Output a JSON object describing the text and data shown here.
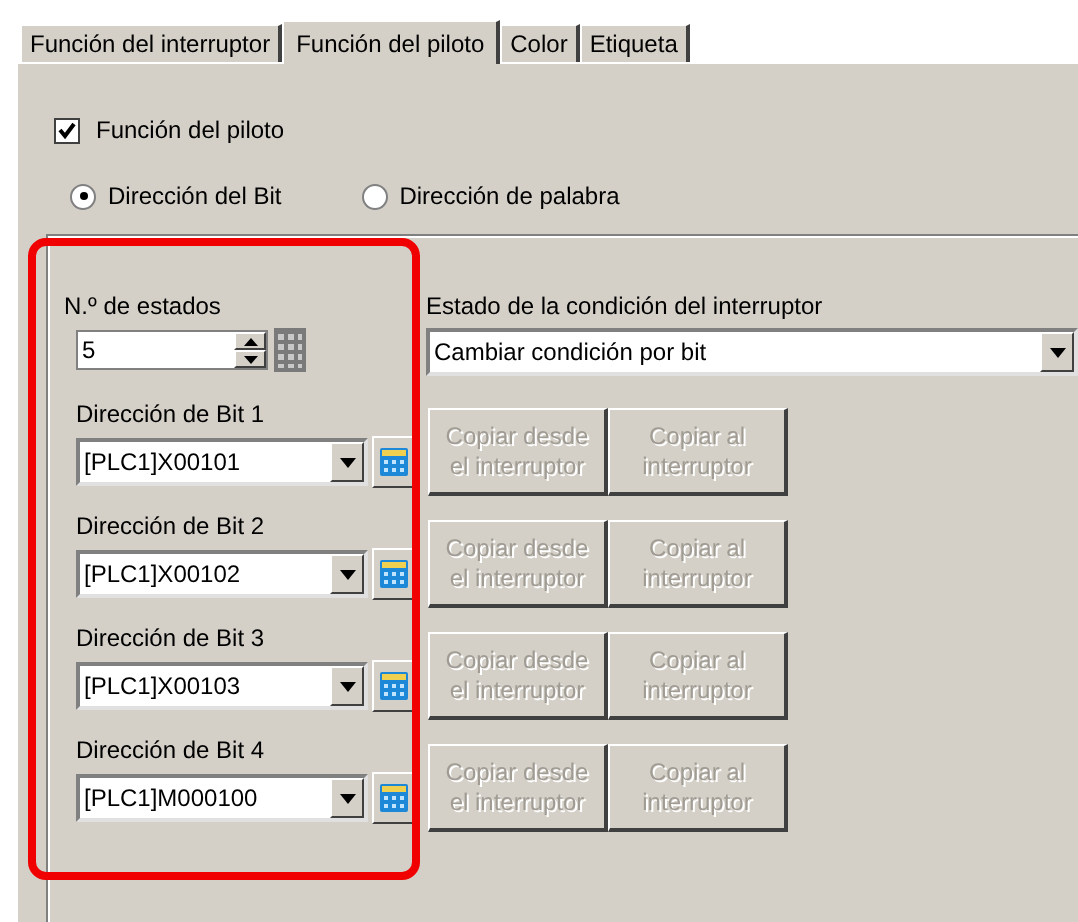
{
  "tabs": [
    {
      "label": "Función del interruptor",
      "selected": false
    },
    {
      "label": "Función del piloto",
      "selected": true
    },
    {
      "label": "Color",
      "selected": false
    },
    {
      "label": "Etiqueta",
      "selected": false
    }
  ],
  "pilot_checkbox": {
    "label": "Función del piloto",
    "checked": true
  },
  "address_type": [
    {
      "label": "Dirección del Bit",
      "selected": true
    },
    {
      "label": "Dirección de palabra",
      "selected": false
    }
  ],
  "states": {
    "label": "N.º de estados",
    "value": "5"
  },
  "condition": {
    "label": "Estado de la condición del interruptor",
    "value": "Cambiar condición por bit"
  },
  "bits": [
    {
      "label": "Dirección de Bit 1",
      "value": "[PLC1]X00101",
      "copy_from": {
        "label": "Copiar desde el interruptor",
        "disabled": true
      },
      "copy_to": {
        "label": "Copiar al interruptor",
        "disabled": true
      }
    },
    {
      "label": "Dirección de Bit 2",
      "value": "[PLC1]X00102",
      "copy_from": {
        "label": "Copiar desde el interruptor",
        "disabled": true
      },
      "copy_to": {
        "label": "Copiar al interruptor",
        "disabled": true
      }
    },
    {
      "label": "Dirección de Bit 3",
      "value": "[PLC1]X00103",
      "copy_from": {
        "label": "Copiar desde el interruptor",
        "disabled": true
      },
      "copy_to": {
        "label": "Copiar al interruptor",
        "disabled": true
      }
    },
    {
      "label": "Dirección de Bit 4",
      "value": "[PLC1]M000100",
      "copy_from": {
        "label": "Copiar desde el interruptor",
        "disabled": true
      },
      "copy_to": {
        "label": "Copiar al interruptor",
        "disabled": true
      }
    }
  ]
}
